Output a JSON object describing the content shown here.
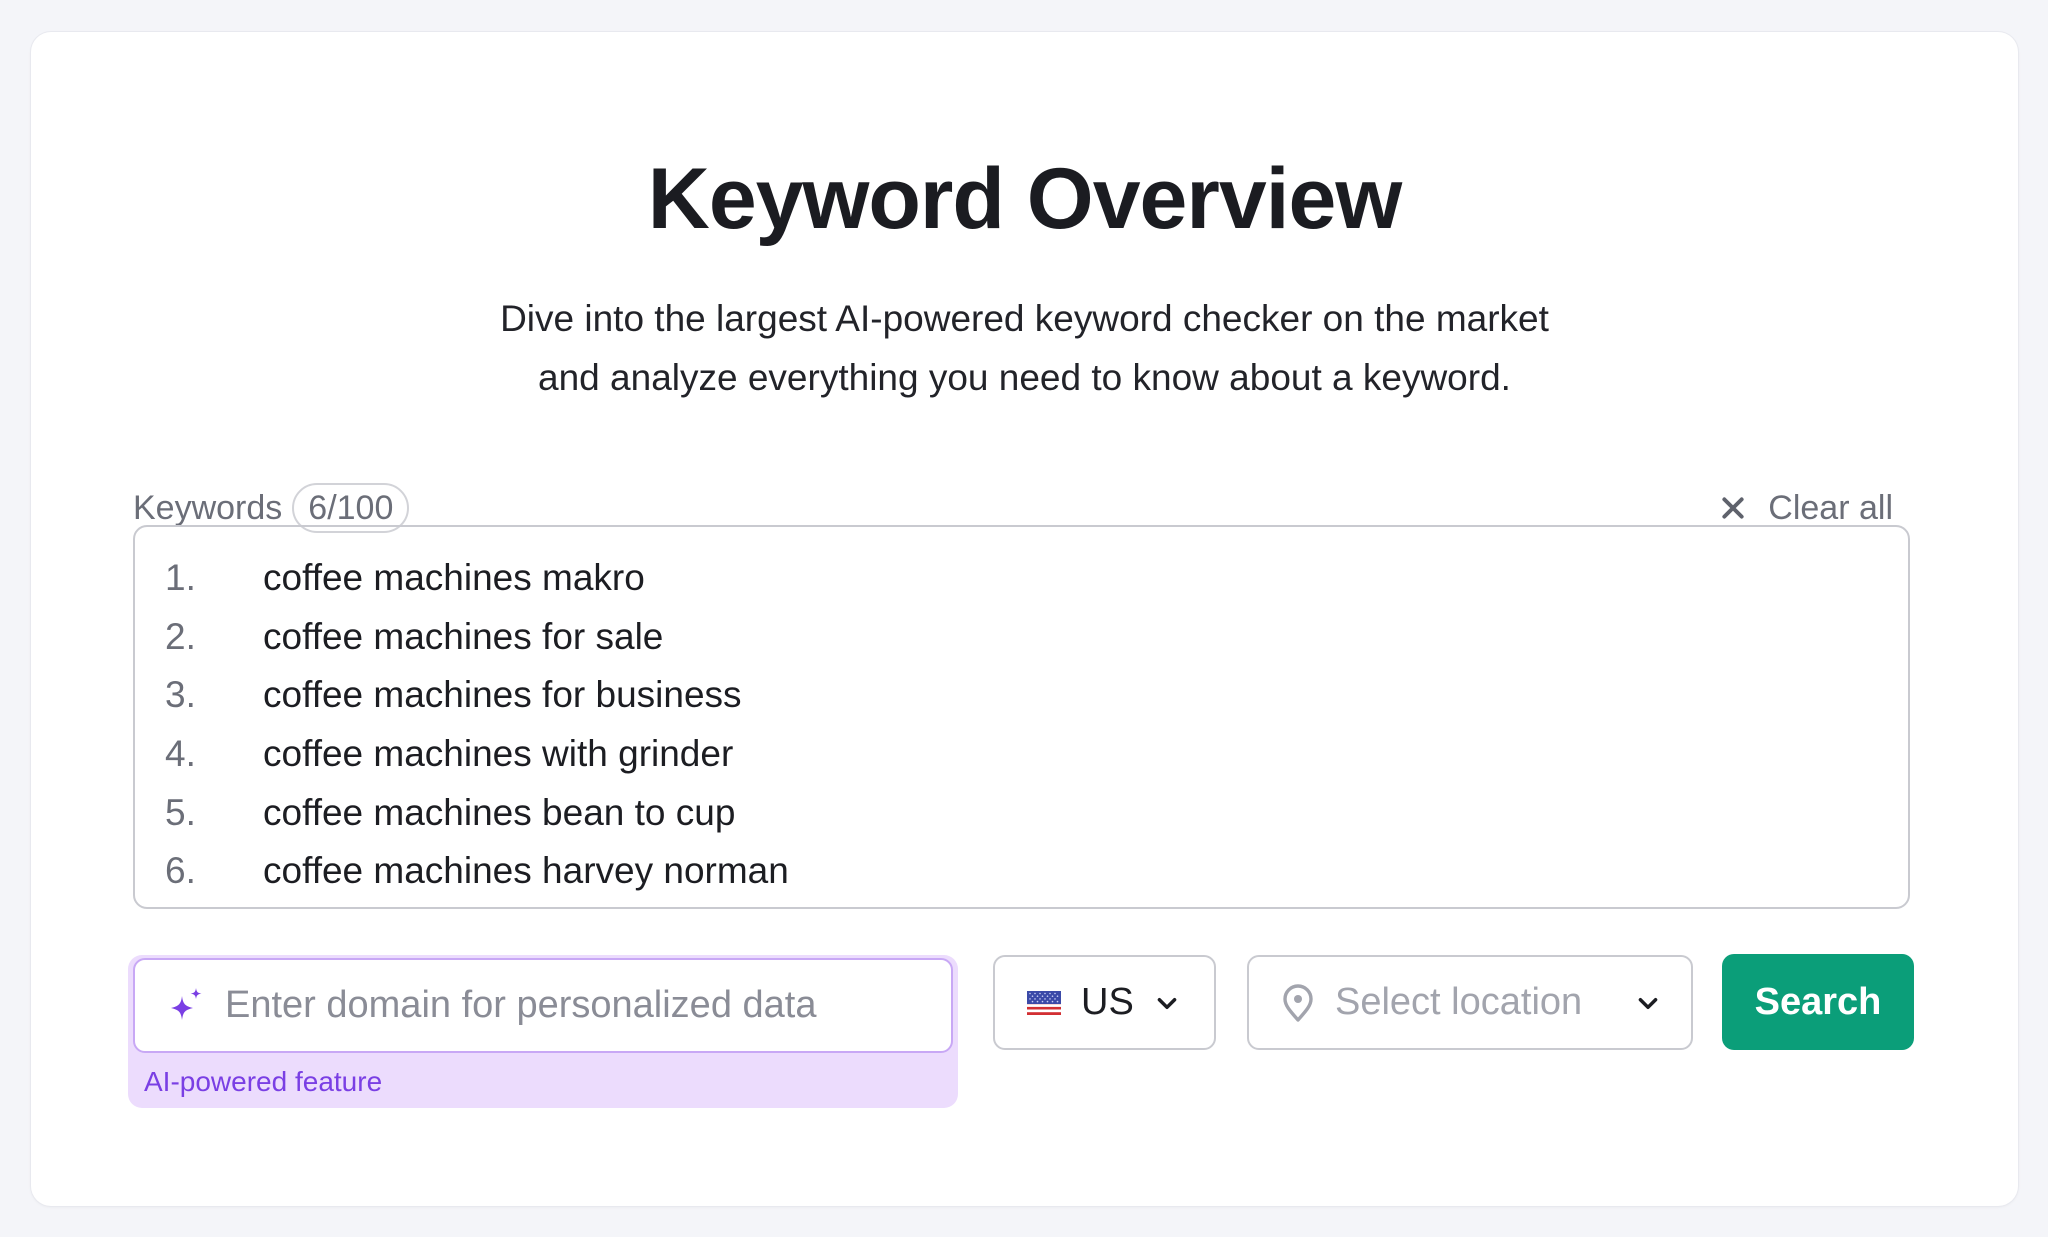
{
  "header": {
    "title": "Keyword Overview",
    "subtitle_lines": [
      "Dive into the largest AI-powered keyword checker on the market",
      "and analyze everything you need to know about a keyword."
    ]
  },
  "keywords": {
    "label": "Keywords",
    "count_badge": "6/100",
    "clear_all_label": "Clear all",
    "items": [
      {
        "num": "1.",
        "text": "coffee machines makro"
      },
      {
        "num": "2.",
        "text": "coffee machines for sale"
      },
      {
        "num": "3.",
        "text": "coffee machines for business"
      },
      {
        "num": "4.",
        "text": "coffee machines with grinder"
      },
      {
        "num": "5.",
        "text": "coffee machines bean to cup"
      },
      {
        "num": "6.",
        "text": "coffee machines harvey norman"
      }
    ]
  },
  "domain_input": {
    "value": "",
    "placeholder": "Enter domain for personalized data",
    "note": "AI-powered feature",
    "icon": "sparkle-icon"
  },
  "country_select": {
    "value": "US",
    "icon": "us-flag-icon"
  },
  "location_select": {
    "placeholder": "Select location",
    "icon": "location-pin-icon"
  },
  "search_button": {
    "label": "Search"
  },
  "colors": {
    "accent_green": "#0b9e79",
    "ai_purple": "#7a3fe4",
    "ai_background": "#ecdcfd",
    "page_background": "#f4f5f9"
  }
}
